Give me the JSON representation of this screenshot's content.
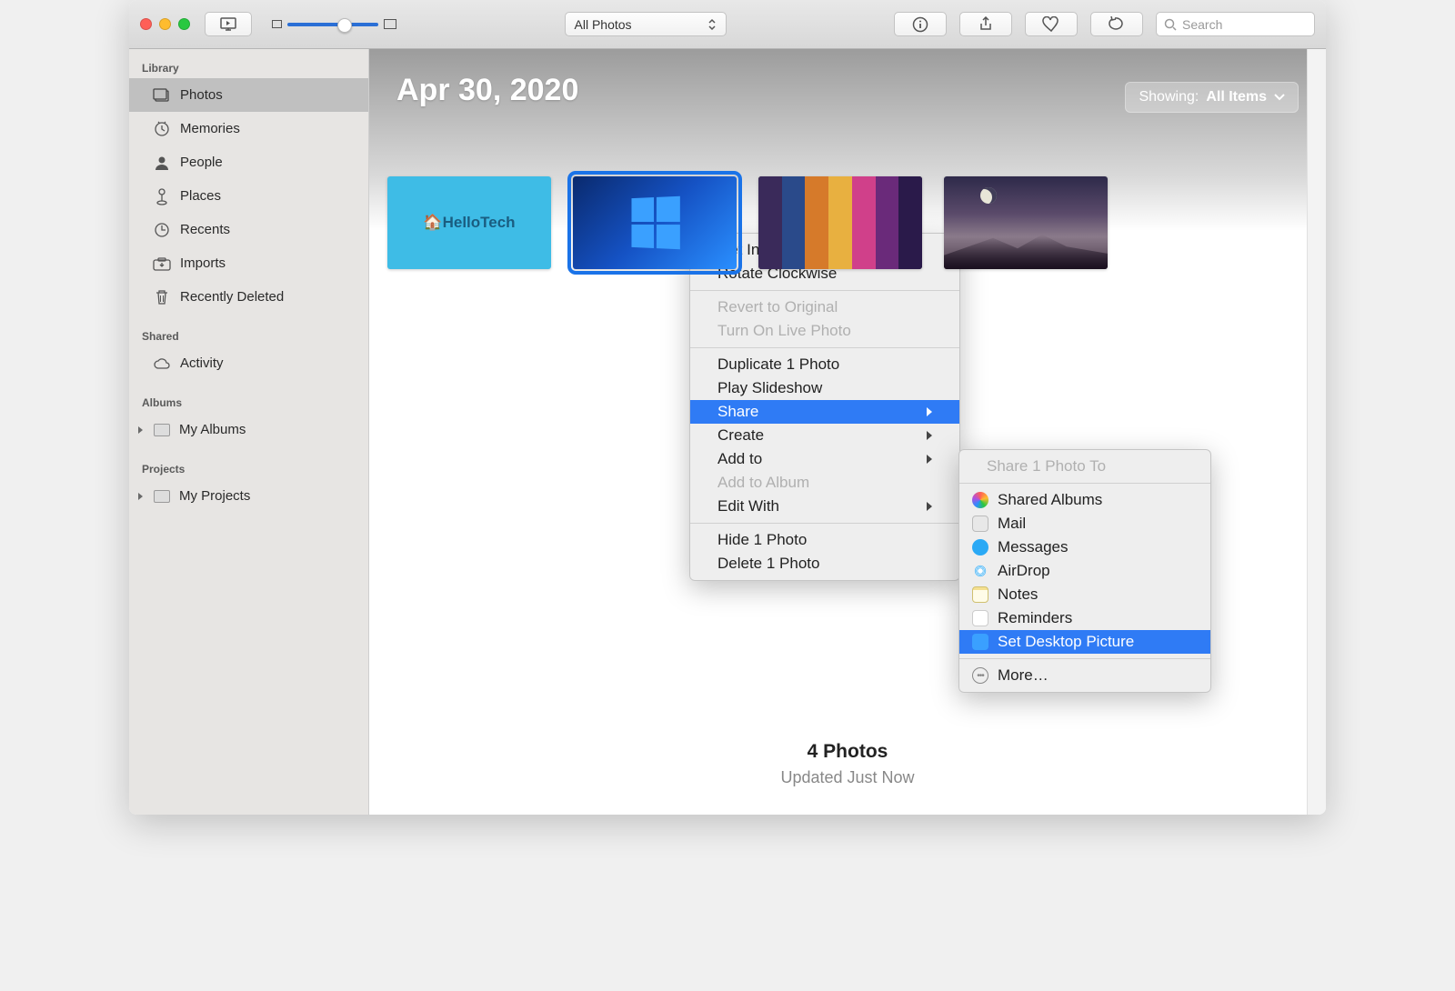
{
  "toolbar": {
    "filter_label": "All Photos",
    "search_placeholder": "Search"
  },
  "sidebar": {
    "sections": {
      "library_header": "Library",
      "shared_header": "Shared",
      "albums_header": "Albums",
      "projects_header": "Projects"
    },
    "library": [
      {
        "label": "Photos"
      },
      {
        "label": "Memories"
      },
      {
        "label": "People"
      },
      {
        "label": "Places"
      },
      {
        "label": "Recents"
      },
      {
        "label": "Imports"
      },
      {
        "label": "Recently Deleted"
      }
    ],
    "shared": [
      {
        "label": "Activity"
      }
    ],
    "albums": [
      {
        "label": "My Albums"
      }
    ],
    "projects": [
      {
        "label": "My Projects"
      }
    ]
  },
  "main": {
    "date_title": "Apr 30, 2020",
    "showing_prefix": "Showing:",
    "showing_value": "All Items",
    "thumb1_caption": "🏠HelloTech",
    "footer_count": "4 Photos",
    "footer_updated": "Updated Just Now"
  },
  "context_menu": {
    "get_info": "Get Info",
    "rotate": "Rotate Clockwise",
    "revert": "Revert to Original",
    "live_photo": "Turn On Live Photo",
    "duplicate": "Duplicate 1 Photo",
    "slideshow": "Play Slideshow",
    "share": "Share",
    "create": "Create",
    "add_to": "Add to",
    "add_to_album": "Add to Album",
    "edit_with": "Edit With",
    "hide": "Hide 1 Photo",
    "delete": "Delete 1 Photo"
  },
  "share_submenu": {
    "header": "Share 1 Photo To",
    "shared_albums": "Shared Albums",
    "mail": "Mail",
    "messages": "Messages",
    "airdrop": "AirDrop",
    "notes": "Notes",
    "reminders": "Reminders",
    "set_desktop": "Set Desktop Picture",
    "more": "More…"
  }
}
